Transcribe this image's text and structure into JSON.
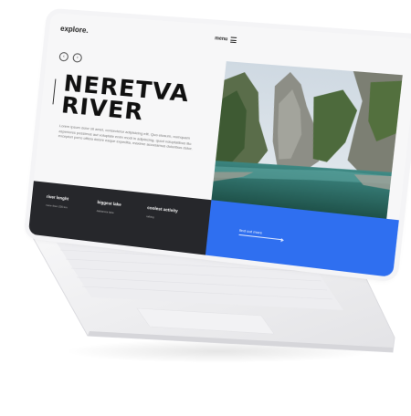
{
  "site": {
    "logo": "explore.",
    "menu_label": "menu",
    "nav": {
      "prev": "‹",
      "next": "›"
    },
    "title_line1": "NERETVA",
    "title_line2": "RIVER",
    "body_text": "Lorem ipsum dolor sit amet, consectetur adipisicing elit. Quo eiusum, numquam asperiores possimus aut voluptate enim modi in adipiscing, quod voluptatibus illo excepturi porro officia dolore eaque expedita, maxime accusamus doloribus dolor.",
    "stats": [
      {
        "title": "river lenght",
        "value": "more than 230 km"
      },
      {
        "title": "biggest lake",
        "value": "Jablanica lake"
      },
      {
        "title": "coolest activity",
        "value": "rafting"
      }
    ],
    "cta_label": "find out more"
  },
  "colors": {
    "dark_bar": "#26272b",
    "cta_blue": "#2f6ff0",
    "screen_bg": "#f7f7f8"
  },
  "icons": {
    "menu": "hamburger-icon",
    "prev": "chevron-left-icon",
    "next": "chevron-right-icon",
    "cta": "arrow-right-icon"
  }
}
